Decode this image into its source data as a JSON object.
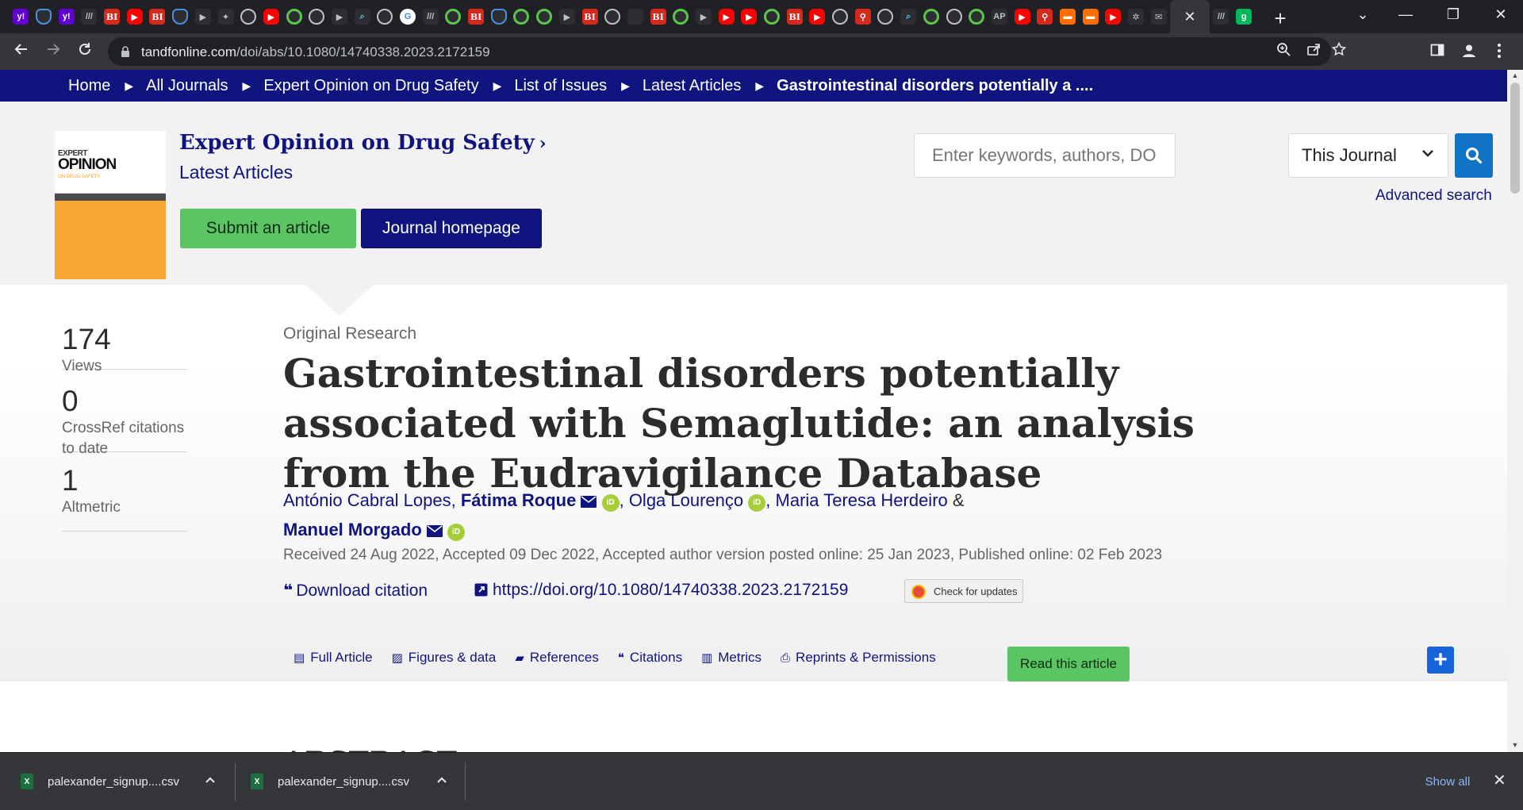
{
  "browser": {
    "url_domain": "tandfonline.com",
    "url_path": "/doi/abs/10.1080/14740338.2023.2172159",
    "tabs": [
      {
        "icon": "yahoo-icon",
        "glyph": "y!"
      },
      {
        "icon": "shield-icon",
        "glyph": ""
      },
      {
        "icon": "yahoo-icon",
        "glyph": "y!"
      },
      {
        "icon": "dark-page-icon",
        "glyph": "///"
      },
      {
        "icon": "business-insider-icon",
        "glyph": "BI"
      },
      {
        "icon": "youtube-icon",
        "glyph": "▶"
      },
      {
        "icon": "business-insider-icon",
        "glyph": "BI"
      },
      {
        "icon": "shield-icon",
        "glyph": ""
      },
      {
        "icon": "dark-page-icon",
        "glyph": "▶"
      },
      {
        "icon": "puzzle-icon",
        "glyph": "✦"
      },
      {
        "icon": "globe-icon",
        "glyph": ""
      },
      {
        "icon": "youtube-icon",
        "glyph": "▶"
      },
      {
        "icon": "play-icon",
        "glyph": ""
      },
      {
        "icon": "globe-icon",
        "glyph": ""
      },
      {
        "icon": "dark-page-icon",
        "glyph": "▶"
      },
      {
        "icon": "search-icon",
        "glyph": "⌕"
      },
      {
        "icon": "globe-icon",
        "glyph": ""
      },
      {
        "icon": "google-icon",
        "glyph": "G"
      },
      {
        "icon": "dark-page-icon",
        "glyph": "///"
      },
      {
        "icon": "play-icon",
        "glyph": ""
      },
      {
        "icon": "business-insider-icon",
        "glyph": "BI"
      },
      {
        "icon": "shield-icon",
        "glyph": ""
      },
      {
        "icon": "play-icon",
        "glyph": ""
      },
      {
        "icon": "play-icon",
        "glyph": ""
      },
      {
        "icon": "dark-page-icon",
        "glyph": "▶"
      },
      {
        "icon": "business-insider-icon",
        "glyph": "BI"
      },
      {
        "icon": "globe-icon",
        "glyph": ""
      },
      {
        "icon": "dark-page-icon",
        "glyph": ""
      },
      {
        "icon": "business-insider-icon",
        "glyph": "BI"
      },
      {
        "icon": "play-icon",
        "glyph": ""
      },
      {
        "icon": "dark-page-icon",
        "glyph": "▶"
      },
      {
        "icon": "youtube-icon",
        "glyph": "▶"
      },
      {
        "icon": "youtube-icon",
        "glyph": "▶"
      },
      {
        "icon": "play-icon",
        "glyph": ""
      },
      {
        "icon": "business-insider-icon",
        "glyph": "BI"
      },
      {
        "icon": "youtube-icon",
        "glyph": "▶"
      },
      {
        "icon": "globe-icon",
        "glyph": ""
      },
      {
        "icon": "podcast-icon",
        "glyph": "⚲"
      },
      {
        "icon": "globe-icon",
        "glyph": ""
      },
      {
        "icon": "search-icon",
        "glyph": "⌕"
      },
      {
        "icon": "play-icon",
        "glyph": ""
      },
      {
        "icon": "globe-icon",
        "glyph": ""
      },
      {
        "icon": "play-icon",
        "glyph": ""
      },
      {
        "icon": "news-icon",
        "glyph": "AP"
      },
      {
        "icon": "youtube-icon",
        "glyph": "▶"
      },
      {
        "icon": "podcast-icon",
        "glyph": "⚲"
      },
      {
        "icon": "bookmark-icon",
        "glyph": "▬"
      },
      {
        "icon": "bookmark-icon",
        "glyph": "▬"
      },
      {
        "icon": "youtube-icon",
        "glyph": "▶"
      },
      {
        "icon": "app-icon",
        "glyph": "✲"
      },
      {
        "icon": "mail-icon",
        "glyph": "✉"
      }
    ],
    "trailing_tabs": [
      {
        "icon": "dark-page-icon",
        "glyph": "///"
      },
      {
        "icon": "grammarly-icon",
        "glyph": "g"
      }
    ],
    "active_tab_close": "✕",
    "new_tab": "+",
    "window_controls": {
      "dropdown": "⌄",
      "minimize": "—",
      "restore": "❐",
      "close": "✕"
    }
  },
  "breadcrumb": {
    "items": [
      "Home",
      "All Journals",
      "Expert Opinion on Drug Safety",
      "List of Issues",
      "Latest Articles"
    ],
    "current": "Gastrointestinal disorders potentially a ...."
  },
  "journal": {
    "title": "Expert Opinion on Drug Safety",
    "subtitle": "Latest Articles",
    "cover_line1": "EXPERT",
    "cover_line2": "OPINION",
    "cover_line3": "ON DRUG SAFETY",
    "submit_label": "Submit an article",
    "homepage_label": "Journal homepage"
  },
  "search": {
    "placeholder": "Enter keywords, authors, DOI, ORCID etc",
    "scope": "This Journal",
    "advanced_label": "Advanced search"
  },
  "metrics": [
    {
      "value": "174",
      "label": "Views"
    },
    {
      "value": "0",
      "label": "CrossRef citations to date"
    },
    {
      "value": "1",
      "label": "Altmetric"
    }
  ],
  "article": {
    "type": "Original Research",
    "title": "Gastrointestinal disorders potentially associated with Semaglutide: an analysis from the Eudravigilance Database",
    "authors": [
      {
        "name": "António Cabral Lopes",
        "sep": ","
      },
      {
        "name": "Fátima Roque",
        "sep": ","
      },
      {
        "name": "Olga Lourenço",
        "sep": ","
      },
      {
        "name": "Maria Teresa Herdeiro",
        "sep": "&"
      },
      {
        "name": "Manuel Morgado",
        "sep": ""
      }
    ],
    "orcid_label": "iD",
    "pub_info": "Received 24 Aug 2022, Accepted 09 Dec 2022, Accepted author version posted online: 25 Jan 2023, Published online: 02 Feb 2023",
    "download_citation": "Download citation",
    "doi": "https://doi.org/10.1080/14740338.2023.2172159",
    "check_updates": "Check for updates",
    "abstract_heading": "ABSTRACT"
  },
  "article_tabs": [
    {
      "icon": "document-icon",
      "glyph": "▤",
      "label": "Full Article"
    },
    {
      "icon": "image-icon",
      "glyph": "▨",
      "label": "Figures & data"
    },
    {
      "icon": "book-icon",
      "glyph": "▰",
      "label": "References"
    },
    {
      "icon": "quote-icon",
      "glyph": "❝",
      "label": "Citations"
    },
    {
      "icon": "bar-chart-icon",
      "glyph": "▥",
      "label": "Metrics"
    },
    {
      "icon": "print-icon",
      "glyph": "⎙",
      "label": "Reprints & Permissions"
    }
  ],
  "read_article_label": "Read this article",
  "share_glyph": "+",
  "downloads": [
    {
      "name": "palexander_signup....csv"
    },
    {
      "name": "palexander_signup....csv"
    }
  ],
  "downloads_show_all": "Show all",
  "colors": {
    "brand_navy": "#10147e",
    "accent_green": "#5bc463",
    "search_blue": "#1173c3",
    "orcid_green": "#a6ce39"
  }
}
